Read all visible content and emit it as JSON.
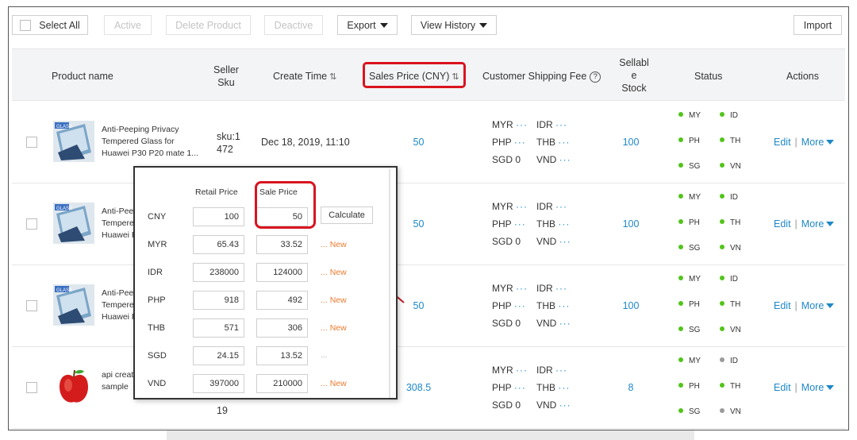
{
  "toolbar": {
    "select_all": "Select All",
    "active": "Active",
    "delete_product": "Delete Product",
    "deactive": "Deactive",
    "export": "Export",
    "view_history": "View History",
    "import": "Import"
  },
  "table": {
    "headers": {
      "product_name": "Product name",
      "seller_sku": "Seller Sku",
      "create_time": "Create Time",
      "sales_price": "Sales Price (CNY)",
      "shipping_fee": "Customer Shipping Fee",
      "sellable_stock_l1": "Sellabl",
      "sellable_stock_l2": "e",
      "sellable_stock_l3": "Stock",
      "status": "Status",
      "actions": "Actions"
    },
    "sort_icon": "⇅",
    "help_icon": "?",
    "rows": [
      {
        "name_l1": "Anti-Peeping Privacy",
        "name_l2": "Tempered Glass for",
        "name_l3": "Huawei P30 P20 mate 1...",
        "sku_l1": "sku:1",
        "sku_l2": "472",
        "create_time": "Dec 18, 2019, 11:10",
        "price": "50",
        "stock": "100"
      },
      {
        "name_l1": "Anti-Peep",
        "name_l2": "Tempered",
        "name_l3": "Huawei P",
        "sku_l1": "",
        "sku_l2": "",
        "create_time": "",
        "price": "50",
        "stock": "100"
      },
      {
        "name_l1": "Anti-Peep",
        "name_l2": "Tempere",
        "name_l3": "Huawei P",
        "sku_l1": "",
        "sku_l2": "",
        "create_time": "",
        "price": "50",
        "stock": "100"
      },
      {
        "name_l1": "api create",
        "name_l2": "sample",
        "name_l3": "",
        "sku_l1": "",
        "sku_l2": "19",
        "create_time": "",
        "price": "308.5",
        "stock": "8"
      }
    ],
    "shipping": {
      "myr": "MYR",
      "idr": "IDR",
      "php": "PHP",
      "thb": "THB",
      "sgd": "SGD 0",
      "vnd": "VND",
      "dots": "···"
    },
    "status_labels": [
      "MY",
      "ID",
      "PH",
      "TH",
      "SG",
      "VN"
    ],
    "status_colors": {
      "on": "#52c41a",
      "off": "#9a9a9a"
    },
    "actions": {
      "edit": "Edit",
      "sep": "|",
      "more": "More"
    }
  },
  "popup": {
    "retail_price_header": "Retail Price",
    "sale_price_header": "Sale Price",
    "calculate": "Calculate",
    "new_label": "New",
    "dots": "...",
    "rows": [
      {
        "currency": "CNY",
        "retail": "100",
        "sale": "50"
      },
      {
        "currency": "MYR",
        "retail": "65.43",
        "sale": "33.52"
      },
      {
        "currency": "IDR",
        "retail": "238000",
        "sale": "124000"
      },
      {
        "currency": "PHP",
        "retail": "918",
        "sale": "492"
      },
      {
        "currency": "THB",
        "retail": "571",
        "sale": "306"
      },
      {
        "currency": "SGD",
        "retail": "24.15",
        "sale": "13.52"
      },
      {
        "currency": "VND",
        "retail": "397000",
        "sale": "210000"
      }
    ]
  },
  "colors": {
    "link": "#1e88c7",
    "highlight": "#d9141f",
    "new_orange": "#ee7b30",
    "status_green": "#52c41a"
  }
}
